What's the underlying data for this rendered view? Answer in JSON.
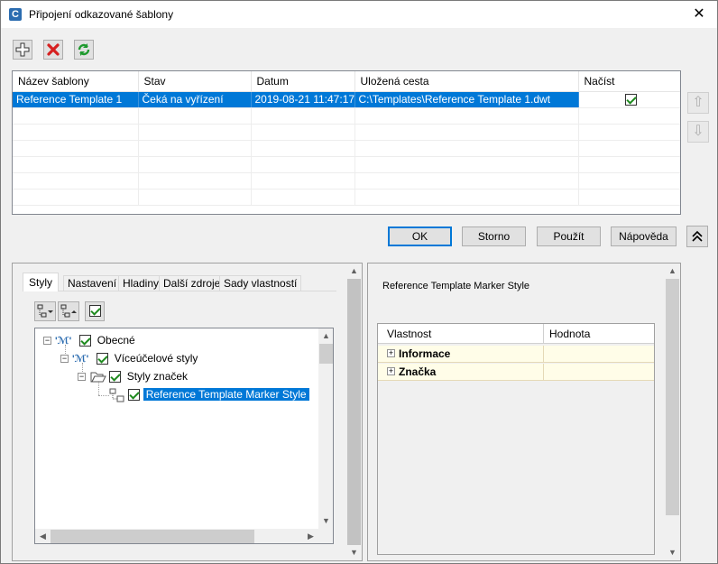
{
  "window": {
    "title": "Připojení odkazované šablony",
    "app_icon_letter": "C",
    "close_glyph": "✕"
  },
  "toolbar": {
    "add_icon": "plus-icon",
    "delete_icon": "red-x-icon",
    "refresh_icon": "refresh-icon"
  },
  "templates_table": {
    "columns": [
      "Název šablony",
      "Stav",
      "Datum",
      "Uložená cesta",
      "Načíst"
    ],
    "rows": [
      {
        "name": "Reference Template 1",
        "status": "Čeká na vyřízení",
        "date": "2019-08-21 11:47:17",
        "path": "C:\\Templates\\Reference Template 1.dwt",
        "load": true
      }
    ]
  },
  "buttons": {
    "ok": "OK",
    "cancel": "Storno",
    "apply": "Použít",
    "help": "Nápověda"
  },
  "tabs": [
    "Styly",
    "Nastavení",
    "Hladiny",
    "Další zdroje",
    "Sady vlastností"
  ],
  "tree": {
    "nodes": [
      {
        "label": "Obecné",
        "checked": true
      },
      {
        "label": "Víceúčelové styly",
        "checked": true
      },
      {
        "label": "Styly značek",
        "checked": true
      },
      {
        "label": "Reference Template Marker Style",
        "checked": true,
        "selected": true
      }
    ]
  },
  "properties": {
    "title": "Reference Template Marker Style",
    "columns": [
      "Vlastnost",
      "Hodnota"
    ],
    "rows": [
      {
        "label": "Informace",
        "value": ""
      },
      {
        "label": "Značka",
        "value": ""
      }
    ]
  },
  "colors": {
    "selection": "#0078d7",
    "accent_check": "#1e8a1e",
    "prop_row": "#fffde8"
  }
}
